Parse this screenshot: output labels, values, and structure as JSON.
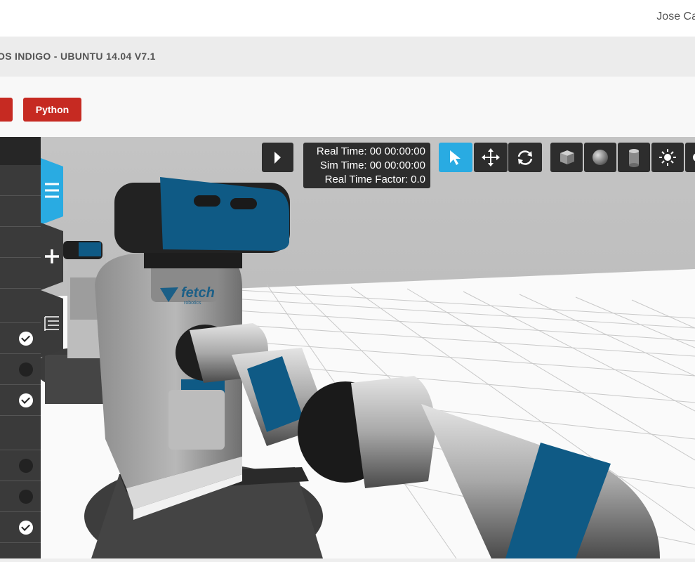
{
  "user": {
    "name": "Jose Ca"
  },
  "header": {
    "title": "OS INDIGO - UBUNTU 14.04 V7.1"
  },
  "buttons": {
    "partial_label": "",
    "python_label": "Python"
  },
  "sim": {
    "real_time": "Real Time: 00 00:00:00",
    "sim_time": "Sim Time: 00 00:00:00",
    "rtf": "Real Time Factor: 0.0"
  },
  "toolbar": {
    "play": "play-icon",
    "tools": [
      "select-arrow-icon",
      "translate-icon",
      "rotate-icon"
    ],
    "shapes": [
      "box-icon",
      "sphere-icon",
      "cylinder-icon",
      "sun-light-icon"
    ]
  },
  "side_panel": {
    "toggles": [
      true,
      false,
      true,
      false,
      false,
      true
    ]
  },
  "robot_branding": {
    "logo": "fetch",
    "sub": "robotics"
  },
  "colors": {
    "accent": "#29abe2",
    "brand_red": "#c62a22",
    "robot_blue": "#0f5a85",
    "panel_dark": "#3a3a3a"
  }
}
